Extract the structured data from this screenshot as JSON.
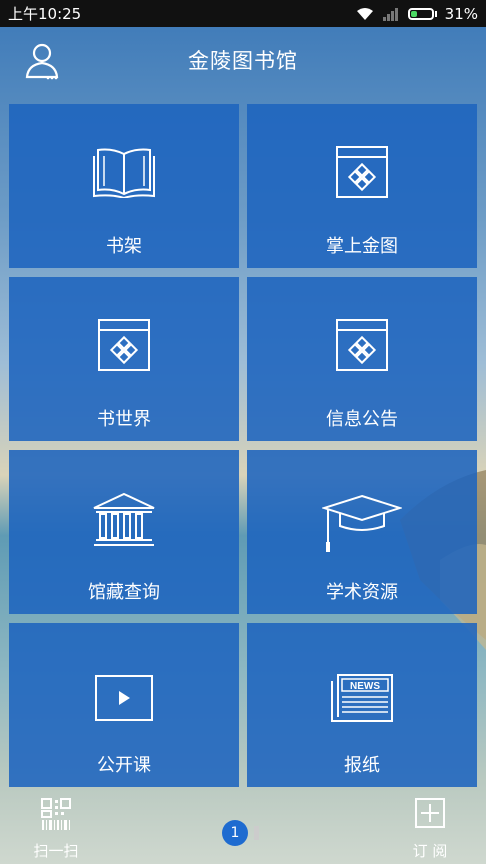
{
  "status_bar": {
    "time": "上午10:25",
    "battery": "31%",
    "battery_level": 0.31
  },
  "header": {
    "title": "金陵图书馆",
    "user_icon": "user-icon"
  },
  "tiles": [
    {
      "label": "书架",
      "icon": "book-icon"
    },
    {
      "label": "掌上金图",
      "icon": "app-window-icon"
    },
    {
      "label": "书世界",
      "icon": "app-window-icon"
    },
    {
      "label": "信息公告",
      "icon": "app-window-icon"
    },
    {
      "label": "馆藏查询",
      "icon": "library-building-icon"
    },
    {
      "label": "学术资源",
      "icon": "graduation-cap-icon"
    },
    {
      "label": "公开课",
      "icon": "video-play-icon"
    },
    {
      "label": "报纸",
      "icon": "newspaper-icon",
      "icon_text": "NEWS"
    }
  ],
  "bottom_bar": {
    "scan_label": "扫一扫",
    "subscribe_label": "订 阅",
    "page_number": "1"
  }
}
